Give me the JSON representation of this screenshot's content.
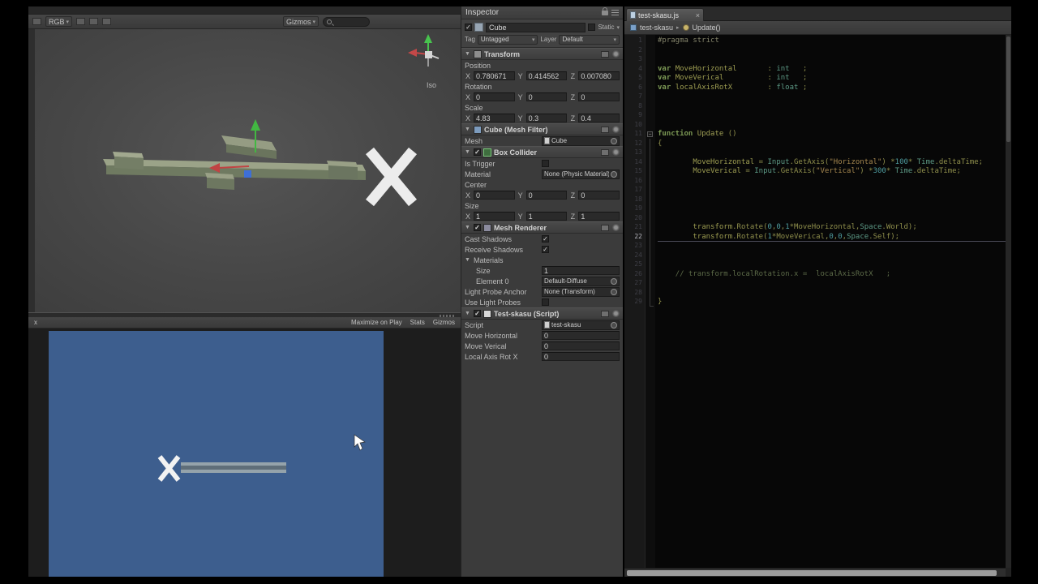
{
  "icons": {
    "foldout": "▼",
    "dropdown": "▾",
    "chevron": "▸",
    "close": "×",
    "check": "✓",
    "minus": "−"
  },
  "colors": {
    "game_background": "#3d5e8e",
    "axis_x": "#c04343",
    "axis_y": "#42b842",
    "axis_z": "#3e6fd6"
  },
  "scene_view": {
    "toolbar": {
      "shading": "RGB",
      "gizmos": "Gizmos"
    },
    "iso_label": "Iso"
  },
  "game_view": {
    "toolbar": {
      "tab_close": "x",
      "maximize": "Maximize on Play",
      "stats": "Stats",
      "gizmos": "Gizmos"
    }
  },
  "inspector": {
    "title": "Inspector",
    "axis": {
      "x": "X",
      "y": "Y",
      "z": "Z"
    },
    "header": {
      "name": "Cube",
      "static_label": "Static",
      "tag_label": "Tag",
      "tag": "Untagged",
      "layer_label": "Layer",
      "layer": "Default"
    },
    "transform": {
      "title": "Transform",
      "position_label": "Position",
      "position": {
        "x": "0.780671",
        "y": "0.414562",
        "z": "0.007080"
      },
      "rotation_label": "Rotation",
      "rotation": {
        "x": "0",
        "y": "0",
        "z": "0"
      },
      "scale_label": "Scale",
      "scale": {
        "x": "4.83",
        "y": "0.3",
        "z": "0.4"
      }
    },
    "mesh_filter": {
      "title": "Cube (Mesh Filter)",
      "mesh_label": "Mesh",
      "mesh": "Cube"
    },
    "box_collider": {
      "title": "Box Collider",
      "is_trigger_label": "Is Trigger",
      "material_label": "Material",
      "material": "None (Physic Material)",
      "center_label": "Center",
      "center": {
        "x": "0",
        "y": "0",
        "z": "0"
      },
      "size_label": "Size",
      "size": {
        "x": "1",
        "y": "1",
        "z": "1"
      }
    },
    "mesh_renderer": {
      "title": "Mesh Renderer",
      "cast_shadows_label": "Cast Shadows",
      "receive_shadows_label": "Receive Shadows",
      "materials_label": "Materials",
      "size_label": "Size",
      "size": "1",
      "element0_label": "Element 0",
      "element0": "Default-Diffuse",
      "light_probe_label": "Light Probe Anchor",
      "light_probe": "None (Transform)",
      "use_light_probes_label": "Use Light Probes"
    },
    "script": {
      "title": "Test-skasu (Script)",
      "script_label": "Script",
      "script": "test-skasu",
      "rows": [
        {
          "label": "Move Horizontal",
          "value": "0"
        },
        {
          "label": "Move Verical",
          "value": "0"
        },
        {
          "label": "Local Axis Rot X",
          "value": "0"
        }
      ]
    }
  },
  "code_editor": {
    "tab_title": "test-skasu.js",
    "breadcrumb": {
      "file": "test-skasu",
      "member": "Update()"
    },
    "lines": [
      {
        "n": 1,
        "tokens": [
          [
            "#pragma strict",
            "pp"
          ]
        ]
      },
      {
        "n": 2,
        "tokens": []
      },
      {
        "n": 3,
        "tokens": []
      },
      {
        "n": 4,
        "tokens": [
          [
            "var ",
            "kw"
          ],
          [
            "MoveHorizontal",
            "id"
          ],
          [
            "       : ",
            "pl"
          ],
          [
            "int",
            "ty"
          ],
          [
            "   ;",
            "pl"
          ]
        ]
      },
      {
        "n": 5,
        "tokens": [
          [
            "var ",
            "kw"
          ],
          [
            "MoveVerical",
            "id"
          ],
          [
            "          : ",
            "pl"
          ],
          [
            "int",
            "ty"
          ],
          [
            "   ;",
            "pl"
          ]
        ]
      },
      {
        "n": 6,
        "tokens": [
          [
            "var ",
            "kw"
          ],
          [
            "localAxisRotX",
            "id"
          ],
          [
            "        : ",
            "pl"
          ],
          [
            "float",
            "ty"
          ],
          [
            " ;",
            "pl"
          ]
        ]
      },
      {
        "n": 7,
        "tokens": []
      },
      {
        "n": 8,
        "tokens": []
      },
      {
        "n": 9,
        "tokens": []
      },
      {
        "n": 10,
        "tokens": []
      },
      {
        "n": 11,
        "tokens": [
          [
            "function ",
            "kw"
          ],
          [
            "Update",
            "fn"
          ],
          [
            " ()",
            "pl"
          ]
        ]
      },
      {
        "n": 12,
        "tokens": [
          [
            "{",
            "pl"
          ]
        ]
      },
      {
        "n": 13,
        "tokens": []
      },
      {
        "n": 14,
        "tokens": [
          [
            "        ",
            "pl"
          ],
          [
            "MoveHorizontal",
            "id"
          ],
          [
            " = ",
            "pl"
          ],
          [
            "Input",
            "ty"
          ],
          [
            ".GetAxis(",
            "pl"
          ],
          [
            "\"Horizontal\"",
            "str"
          ],
          [
            ") *",
            "pl"
          ],
          [
            "100",
            "num"
          ],
          [
            "* ",
            "pl"
          ],
          [
            "Time",
            "ty"
          ],
          [
            ".deltaTime;",
            "pl"
          ]
        ]
      },
      {
        "n": 15,
        "tokens": [
          [
            "        ",
            "pl"
          ],
          [
            "MoveVerical",
            "id"
          ],
          [
            " = ",
            "pl"
          ],
          [
            "Input",
            "ty"
          ],
          [
            ".GetAxis(",
            "pl"
          ],
          [
            "\"Vertical\"",
            "str"
          ],
          [
            ") *",
            "pl"
          ],
          [
            "300",
            "num"
          ],
          [
            "* ",
            "pl"
          ],
          [
            "Time",
            "ty"
          ],
          [
            ".deltaTime;",
            "pl"
          ]
        ]
      },
      {
        "n": 16,
        "tokens": []
      },
      {
        "n": 17,
        "tokens": []
      },
      {
        "n": 18,
        "tokens": []
      },
      {
        "n": 19,
        "tokens": []
      },
      {
        "n": 20,
        "tokens": []
      },
      {
        "n": 21,
        "tokens": [
          [
            "        ",
            "pl"
          ],
          [
            "transform",
            "id"
          ],
          [
            ".Rotate(",
            "pl"
          ],
          [
            "0",
            "num"
          ],
          [
            ",",
            "pl"
          ],
          [
            "0",
            "num"
          ],
          [
            ",",
            "pl"
          ],
          [
            "1",
            "num"
          ],
          [
            "*MoveHorizontal,",
            "pl"
          ],
          [
            "Space",
            "ty"
          ],
          [
            ".World);",
            "pl"
          ]
        ]
      },
      {
        "n": 22,
        "hl": true,
        "tokens": [
          [
            "        ",
            "pl"
          ],
          [
            "transform",
            "id"
          ],
          [
            ".Rotate(",
            "pl"
          ],
          [
            "1",
            "num"
          ],
          [
            "*MoveVerical,",
            "pl"
          ],
          [
            "0",
            "num"
          ],
          [
            ",",
            "pl"
          ],
          [
            "0",
            "num"
          ],
          [
            ",",
            "pl"
          ],
          [
            "Space",
            "ty"
          ],
          [
            ".Self);",
            "pl"
          ]
        ]
      },
      {
        "n": 23,
        "tokens": []
      },
      {
        "n": 24,
        "tokens": []
      },
      {
        "n": 25,
        "tokens": []
      },
      {
        "n": 26,
        "tokens": [
          [
            "    ",
            "pl"
          ],
          [
            "// transform.localRotation.x =  localAxisRotX   ;",
            "cm"
          ]
        ]
      },
      {
        "n": 27,
        "tokens": []
      },
      {
        "n": 28,
        "tokens": []
      },
      {
        "n": 29,
        "tokens": [
          [
            "}",
            "pl"
          ]
        ]
      }
    ]
  }
}
